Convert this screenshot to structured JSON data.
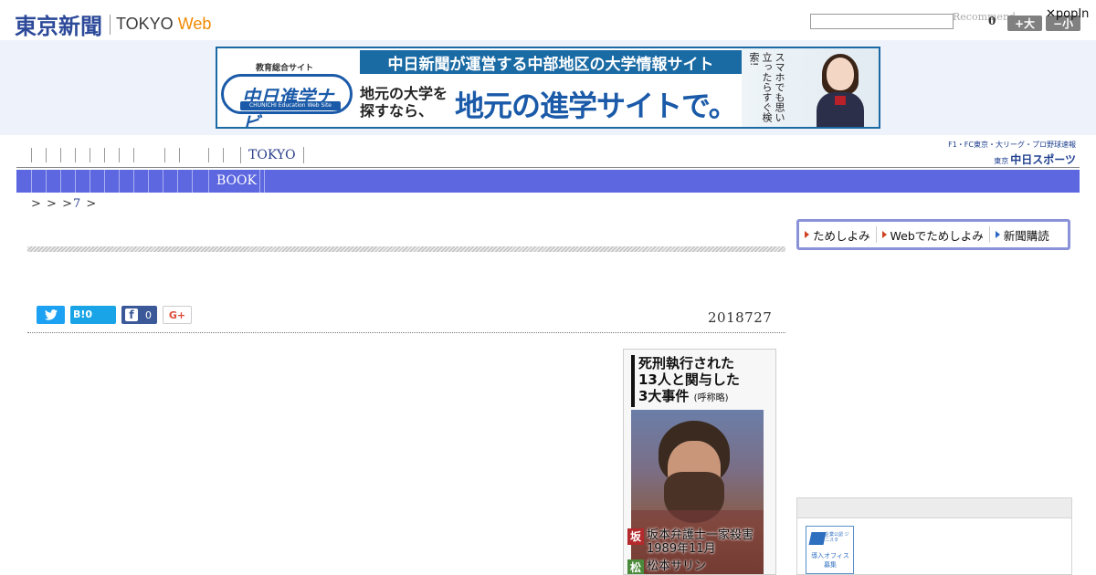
{
  "header": {
    "logo_jp": "東京新聞",
    "logo_tokyo": "TOKYO",
    "logo_web": "Web",
    "search_value": "",
    "recommend_text": "Recommended by",
    "count": "0",
    "font_up": "+大",
    "font_down": "−小",
    "popin": "✕popIn"
  },
  "ad": {
    "logo_small": "教育総合サイト",
    "logo_main": "中日進学ナビ",
    "logo_strip": "CHUNICHI Education Web Site",
    "headline": "中日新聞が運営する中部地区の大学情報サイト",
    "sub1": "地元の大学を探すなら、",
    "sub2": "地元の進学サイトで。",
    "side_text": "スマホでも思い立ったらすぐ検索!"
  },
  "nav1": {
    "tokyo": "TOKYO"
  },
  "chunichi": {
    "top": "F1・FC東京・大リーグ・プロ野球速報",
    "prefix": "東京",
    "main": "中日スポーツ"
  },
  "nav2": {
    "book": "BOOK"
  },
  "breadcrumb": {
    "sep1": ">",
    "sep2": ">",
    "sep3": ">",
    "link": "7",
    "sep4": ">"
  },
  "share": {
    "hatena": "B!0",
    "fb_icon": "f",
    "fb_count": "0",
    "gplus": "G+"
  },
  "article": {
    "date": "2018727"
  },
  "figure": {
    "title_l1": "死刑執行された",
    "title_l2": "13人と関与した",
    "title_l3": "3大事件",
    "title_note": "(呼称略)",
    "row1_tag": "坂",
    "row1_text": "坂本弁護士一家殺害",
    "row1_sub": "1989年11月",
    "row2_tag": "松",
    "row2_text": "松本サリン"
  },
  "subscribe": {
    "item1": "ためしよみ",
    "item2": "Webでためしよみ",
    "item3": "新聞購読"
  },
  "right_badge": {
    "small": "企業公認 ジニスタ",
    "text": "導入オフィス 募集"
  },
  "colors": {
    "nav_blue": "#5d67e0",
    "logo_blue": "#2d4a9a",
    "web_orange": "#f08a00"
  }
}
